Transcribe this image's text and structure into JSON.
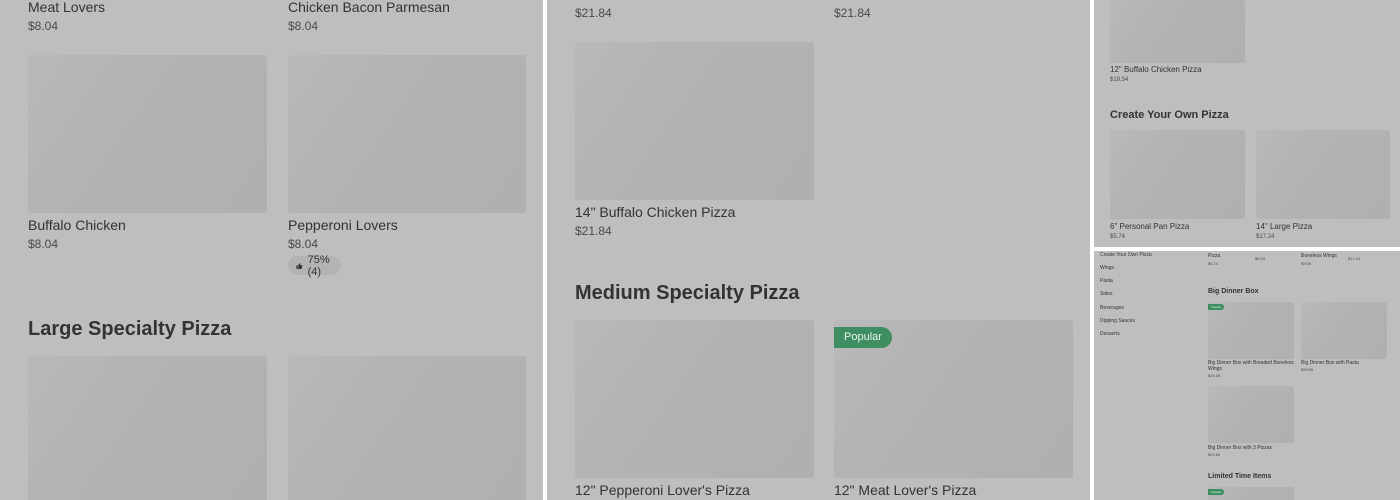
{
  "panel1": {
    "row1": [
      {
        "name": "Meat Lovers",
        "price": "$8.04"
      },
      {
        "name": "Chicken Bacon Parmesan",
        "price": "$8.04"
      }
    ],
    "row2": [
      {
        "name": "Buffalo Chicken",
        "price": "$8.04"
      },
      {
        "name": "Pepperoni Lovers",
        "price": "$8.04",
        "rating": "75% (4)"
      }
    ],
    "section_title": "Large Specialty Pizza"
  },
  "panel2": {
    "row1_prices": [
      "$21.84",
      "$21.84"
    ],
    "buffalo": {
      "name": "14\" Buffalo Chicken Pizza",
      "price": "$21.84"
    },
    "section_title": "Medium Specialty Pizza",
    "badge": "Popular",
    "row3": [
      {
        "name": "12\" Pepperoni Lover's Pizza"
      },
      {
        "name": "12\" Meat Lover's Pizza"
      }
    ]
  },
  "panel3": {
    "buffalo": {
      "name": "12\" Buffalo Chicken Pizza",
      "price": "$19.54"
    },
    "section_title": "Create Your Own Pizza",
    "items": [
      {
        "name": "6\" Personal Pan Pizza",
        "price": "$5.74"
      },
      {
        "name": "14\" Large Pizza",
        "price": "$17.24"
      }
    ]
  },
  "panel4": {
    "nav": [
      "Create Your Own Pizza",
      "Wings",
      "Pasta",
      "Sides",
      "Beverages",
      "Dipping Sauces",
      "Desserts"
    ],
    "top_row": [
      {
        "name": "Pizza",
        "price": "$5.74"
      },
      {
        "name": "",
        "price": "$9.04"
      },
      {
        "name": "Boneless Wings",
        "price": "$9.59"
      },
      {
        "name": "",
        "price": "$17.24"
      }
    ],
    "section_title": "Big Dinner Box",
    "badge": "Popular",
    "items": [
      {
        "name": "Big Dinner Box with Breaded Boneless Wings",
        "price": "$29.65"
      },
      {
        "name": "Big Dinner Box with Pasta",
        "price": "$29.65"
      },
      {
        "name": "Big Dinner Box with 3 Pizzas",
        "price": "$29.65"
      }
    ],
    "section2_title": "Limited Time Items",
    "badge2": "Popular"
  }
}
